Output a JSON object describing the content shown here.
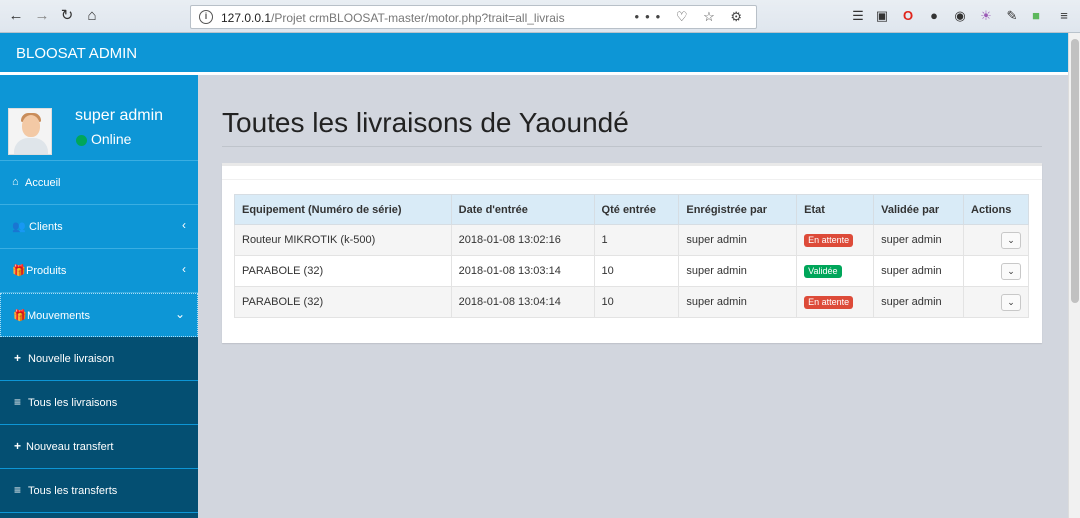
{
  "browser": {
    "url_host": "127.0.0.1",
    "url_path": "/Projet crmBLOOSAT-master/motor.php?trait=all_livrais",
    "url_actions": "••• ♡ ☆ ⚙"
  },
  "app": {
    "brand": "BLOOSAT ADMIN"
  },
  "user": {
    "name": "super admin",
    "status": "Online"
  },
  "sidebar": {
    "items": [
      {
        "icon": "⌂",
        "label": "Accueil",
        "arrow": ""
      },
      {
        "icon": "👥",
        "label": "Clients",
        "arrow": "‹"
      },
      {
        "icon": "🎁",
        "label": "Produits",
        "arrow": "‹"
      },
      {
        "icon": "🎁",
        "label": "Mouvements",
        "arrow": "⌄"
      }
    ],
    "subitems": [
      {
        "icon": "+",
        "label": "Nouvelle livraison"
      },
      {
        "icon": "≡",
        "label": "Tous les livraisons"
      },
      {
        "icon": "+",
        "label": "Nouveau transfert"
      },
      {
        "icon": "≡",
        "label": "Tous les transferts"
      }
    ]
  },
  "page": {
    "title": "Toutes les livraisons de Yaoundé"
  },
  "table": {
    "headers": [
      "Equipement (Numéro de série)",
      "Date d'entrée",
      "Qté entrée",
      "Enrégistrée par",
      "Etat",
      "Validée par",
      "Actions"
    ],
    "rows": [
      {
        "equipement": "Routeur MIKROTIK (k-500)",
        "date": "2018-01-08 13:02:16",
        "qte": "1",
        "enregistree": "super admin",
        "etat": "En attente",
        "validee": "super admin",
        "action": "⌄"
      },
      {
        "equipement": "PARABOLE (32)",
        "date": "2018-01-08 13:03:14",
        "qte": "10",
        "enregistree": "super admin",
        "etat": "Validée",
        "validee": "super admin",
        "action": "⌄"
      },
      {
        "equipement": "PARABOLE (32)",
        "date": "2018-01-08 13:04:14",
        "qte": "10",
        "enregistree": "super admin",
        "etat": "En attente",
        "validee": "super admin",
        "action": "⌄"
      }
    ]
  },
  "colors": {
    "primary": "#0d96d6",
    "submenu": "#044f72",
    "status_pending": "#dd4b39",
    "status_valid": "#00a65a"
  }
}
